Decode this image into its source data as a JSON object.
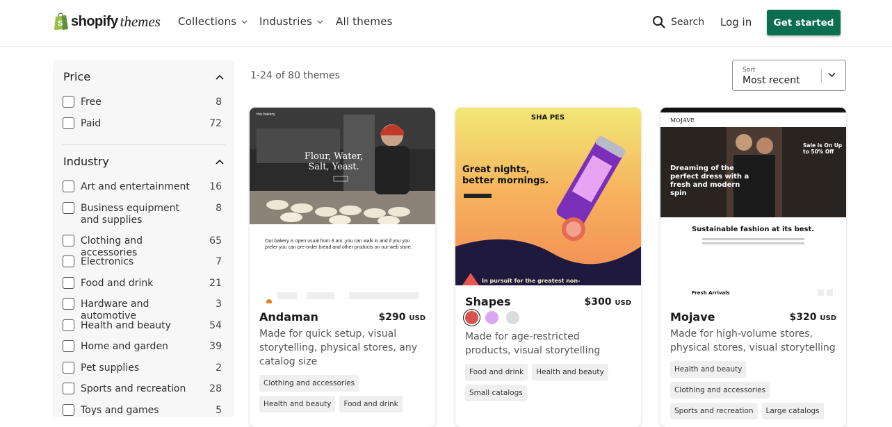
{
  "header": {
    "brand": "shopify",
    "brand_sub": "themes",
    "nav": [
      "Collections",
      "Industries",
      "All themes"
    ],
    "search_label": "Search",
    "login_label": "Log in",
    "cta_label": "Get started",
    "cta_color": "#0a6e4f"
  },
  "filters": {
    "price": {
      "title": "Price",
      "options": [
        {
          "label": "Free",
          "count": "8"
        },
        {
          "label": "Paid",
          "count": "72"
        }
      ]
    },
    "industry": {
      "title": "Industry",
      "options": [
        {
          "label": "Art and entertainment",
          "count": "16"
        },
        {
          "label": "Business equipment and supplies",
          "count": "8"
        },
        {
          "label": "Clothing and accessories",
          "count": "65"
        },
        {
          "label": "Electronics",
          "count": "7"
        },
        {
          "label": "Food and drink",
          "count": "21"
        },
        {
          "label": "Hardware and automotive",
          "count": "3"
        },
        {
          "label": "Health and beauty",
          "count": "54"
        },
        {
          "label": "Home and garden",
          "count": "39"
        },
        {
          "label": "Pet supplies",
          "count": "2"
        },
        {
          "label": "Sports and recreation",
          "count": "28"
        },
        {
          "label": "Toys and games",
          "count": "5"
        }
      ]
    }
  },
  "results": {
    "count_text": "1-24 of 80 themes",
    "sort_label": "Sort",
    "sort_value": "Most recent"
  },
  "themes": [
    {
      "name": "Andaman",
      "price": "$290",
      "currency": "USD",
      "description": "Made for quick setup, visual storytelling, physical stores, any catalog size",
      "tags": [
        "Clothing and accessories",
        "Health and beauty",
        "Food and drink"
      ],
      "preview": {
        "store": "the bakery",
        "hero_line1": "Flour, Water,",
        "hero_line2": "Salt, Yeast.",
        "body": "Our bakery is open usual from 8 am, you can walk in and if you you prefer you can pre-order bread and other products on our web store."
      }
    },
    {
      "name": "Shapes",
      "price": "$300",
      "currency": "USD",
      "description": "Made for age-restricted products, visual storytelling",
      "tags": [
        "Food and drink",
        "Health and beauty",
        "Small catalogs"
      ],
      "swatches": [
        "#d9534f",
        "#d9a8f0",
        "#dcdcdc"
      ],
      "preview": {
        "logo": "SHA PES",
        "hero_line1": "Great nights,",
        "hero_line2": "better mornings.",
        "footer": "In pursuit for the greatest non-"
      }
    },
    {
      "name": "Mojave",
      "price": "$320",
      "currency": "USD",
      "description": "Made for high-volume stores, physical stores, visual storytelling",
      "tags": [
        "Health and beauty",
        "Clothing and accessories",
        "Sports and recreation",
        "Large catalogs"
      ],
      "preview": {
        "logo": "MOJAVE",
        "hero": "Dreaming of the perfect dress with a fresh and modern spin",
        "sale": "Sale is On Up to 50% Off",
        "tagline": "Sustainable fashion at its best.",
        "section": "Fresh Arrivals"
      }
    }
  ]
}
